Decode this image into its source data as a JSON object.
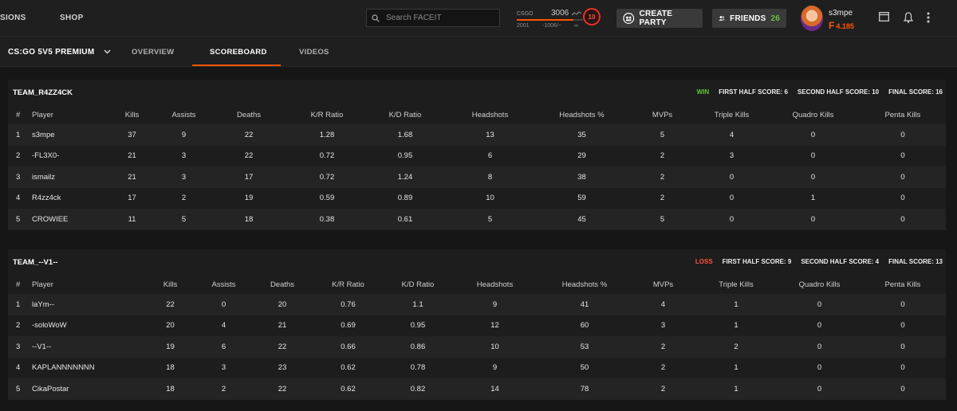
{
  "nav": {
    "item1": "SIONS",
    "item2": "SHOP"
  },
  "search": {
    "placeholder": "Search FACEIT"
  },
  "elo": {
    "game": "CSGO",
    "value": "3006",
    "low": "2001",
    "diff": "-1006/−",
    "high": "∞",
    "level": "10",
    "progress": 0.85
  },
  "header": {
    "create_party": "CREATE PARTY",
    "friends_label": "FRIENDS",
    "friends_count": "26",
    "username": "s3mpe",
    "points": "4.185"
  },
  "tabs": {
    "match": "CS:GO 5V5 PREMIUM",
    "overview": "OVERVIEW",
    "scoreboard": "SCOREBOARD",
    "videos": "VIDEOS",
    "active": "scoreboard"
  },
  "columns": [
    "#",
    "Player",
    "Kills",
    "Assists",
    "Deaths",
    "K/R Ratio",
    "K/D Ratio",
    "Headshots",
    "Headshots %",
    "MVPs",
    "Triple Kills",
    "Quadro Kills",
    "Penta Kills"
  ],
  "teams": [
    {
      "name": "TEAM_R4ZZ4CK",
      "result": "WIN",
      "first_half": "FIRST HALF SCORE: 6",
      "second_half": "SECOND HALF SCORE: 10",
      "final": "FINAL SCORE: 16",
      "players": [
        [
          "1",
          "s3mpe",
          "37",
          "9",
          "22",
          "1.28",
          "1.68",
          "13",
          "35",
          "5",
          "4",
          "0",
          "0"
        ],
        [
          "2",
          "-FL3X0-",
          "21",
          "3",
          "22",
          "0.72",
          "0.95",
          "6",
          "29",
          "2",
          "3",
          "0",
          "0"
        ],
        [
          "3",
          "ismailz",
          "21",
          "3",
          "17",
          "0.72",
          "1.24",
          "8",
          "38",
          "2",
          "0",
          "0",
          "0"
        ],
        [
          "4",
          "R4zz4ck",
          "17",
          "2",
          "19",
          "0.59",
          "0.89",
          "10",
          "59",
          "2",
          "0",
          "1",
          "0"
        ],
        [
          "5",
          "CROWIEE",
          "11",
          "5",
          "18",
          "0.38",
          "0.61",
          "5",
          "45",
          "5",
          "0",
          "0",
          "0"
        ]
      ]
    },
    {
      "name": "TEAM_--V1--",
      "result": "LOSS",
      "first_half": "FIRST HALF SCORE: 9",
      "second_half": "SECOND HALF SCORE: 4",
      "final": "FINAL SCORE: 13",
      "players": [
        [
          "1",
          "laYm--",
          "22",
          "0",
          "20",
          "0.76",
          "1.1",
          "9",
          "41",
          "4",
          "1",
          "0",
          "0"
        ],
        [
          "2",
          "-soloWoW",
          "20",
          "4",
          "21",
          "0.69",
          "0.95",
          "12",
          "60",
          "3",
          "1",
          "0",
          "0"
        ],
        [
          "3",
          "--V1--",
          "19",
          "6",
          "22",
          "0.66",
          "0.86",
          "10",
          "53",
          "2",
          "2",
          "0",
          "0"
        ],
        [
          "4",
          "KAPLANNNNNNN",
          "18",
          "3",
          "23",
          "0.62",
          "0.78",
          "9",
          "50",
          "2",
          "1",
          "0",
          "0"
        ],
        [
          "5",
          "CikaPostar",
          "18",
          "2",
          "22",
          "0.62",
          "0.82",
          "14",
          "78",
          "2",
          "1",
          "0",
          "0"
        ]
      ]
    }
  ]
}
